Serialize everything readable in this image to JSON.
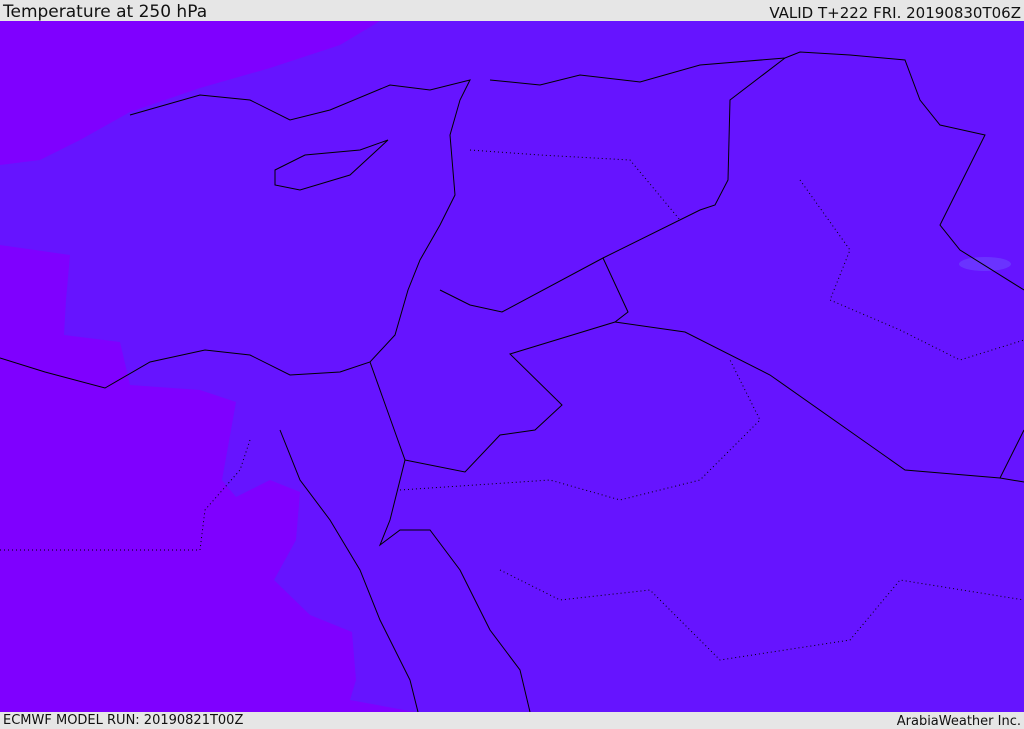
{
  "header": {
    "title": "Temperature at 250 hPa",
    "valid": "VALID T+222 FRI. 20190830T06Z"
  },
  "footer": {
    "model_run": "ECMWF MODEL RUN: 20190821T00Z",
    "credit": "ArabiaWeather Inc."
  },
  "colors": {
    "main_field": "#6614ff",
    "cold_field": "#7f00ff",
    "warm_spot": "#6a33ff",
    "borders": "#000000",
    "bars": "#e6e6e6"
  }
}
